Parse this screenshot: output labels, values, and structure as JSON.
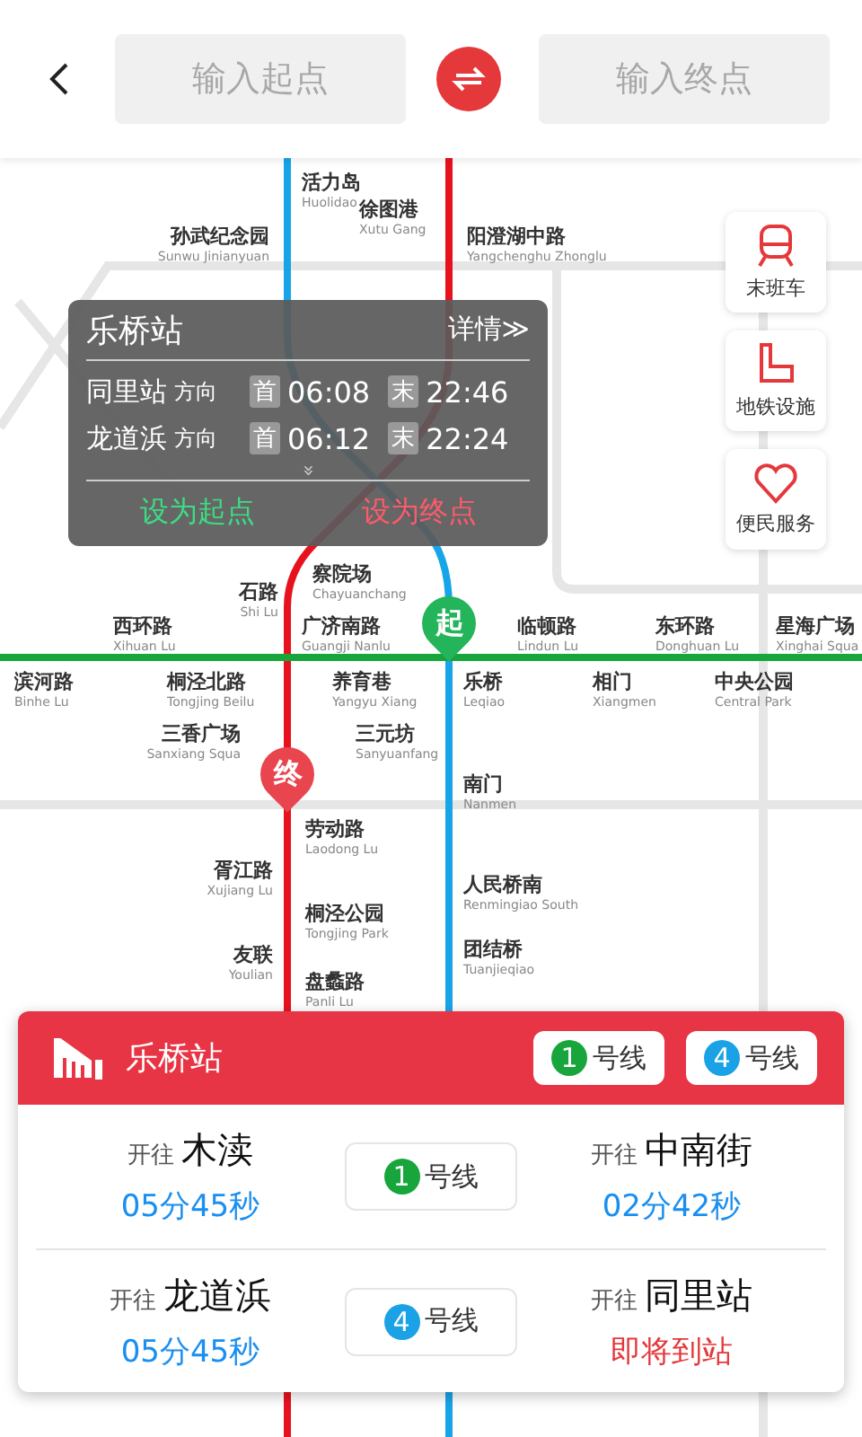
{
  "search": {
    "start_placeholder": "输入起点",
    "end_placeholder": "输入终点"
  },
  "side_buttons": [
    {
      "kind": "train",
      "label": "末班车"
    },
    {
      "kind": "facility",
      "label": "地铁设施"
    },
    {
      "kind": "service",
      "label": "便民服务"
    }
  ],
  "map": {
    "stations": [
      {
        "name": "活力岛",
        "name_en": "Huolidao"
      },
      {
        "name": "徐图港",
        "name_en": "Xutu Gang"
      },
      {
        "name": "孙武纪念园",
        "name_en": "Sunwu Jinianyuan"
      },
      {
        "name": "阳澄湖中路",
        "name_en": "Yangchenghu Zhonglu"
      },
      {
        "name": "石路",
        "name_en": "Shi Lu"
      },
      {
        "name": "察院场",
        "name_en": "Chayuanchang"
      },
      {
        "name": "西环路",
        "name_en": "Xihuan Lu"
      },
      {
        "name": "广济南路",
        "name_en": "Guangji Nanlu"
      },
      {
        "name": "临顿路",
        "name_en": "Lindun Lu"
      },
      {
        "name": "东环路",
        "name_en": "Donghuan Lu"
      },
      {
        "name": "星海广场",
        "name_en": "Xinghai Squa"
      },
      {
        "name": "滨河路",
        "name_en": "Binhe Lu"
      },
      {
        "name": "桐泾北路",
        "name_en": "Tongjing Beilu"
      },
      {
        "name": "养育巷",
        "name_en": "Yangyu Xiang"
      },
      {
        "name": "乐桥",
        "name_en": "Leqiao"
      },
      {
        "name": "相门",
        "name_en": "Xiangmen"
      },
      {
        "name": "中央公园",
        "name_en": "Central Park"
      },
      {
        "name": "三香广场",
        "name_en": "Sanxiang Squa"
      },
      {
        "name": "三元坊",
        "name_en": "Sanyuanfang"
      },
      {
        "name": "南门",
        "name_en": "Nanmen"
      },
      {
        "name": "劳动路",
        "name_en": "Laodong Lu"
      },
      {
        "name": "胥江路",
        "name_en": "Xujiang Lu"
      },
      {
        "name": "人民桥南",
        "name_en": "Renmingiao South"
      },
      {
        "name": "桐泾公园",
        "name_en": "Tongjing Park"
      },
      {
        "name": "友联",
        "name_en": "Youlian"
      },
      {
        "name": "团结桥",
        "name_en": "Tuanjieqiao"
      },
      {
        "name": "盘蠡路",
        "name_en": "Panli Lu"
      }
    ],
    "start_pin": "起",
    "end_pin": "终"
  },
  "popup": {
    "station": "乐桥站",
    "details": "详情≫",
    "directions": [
      {
        "station": "同里站",
        "suffix": "方向",
        "first_tag": "首",
        "first": "06:08",
        "last_tag": "末",
        "last": "22:46"
      },
      {
        "station": "龙道浜",
        "suffix": "方向",
        "first_tag": "首",
        "first": "06:12",
        "last_tag": "末",
        "last": "22:24"
      }
    ],
    "more": "»",
    "actions": [
      {
        "kind": "start",
        "label": "设为起点"
      },
      {
        "kind": "end",
        "label": "设为终点"
      }
    ]
  },
  "card": {
    "station": "乐桥站",
    "lines": [
      {
        "number": "1",
        "label": "号线",
        "color": "#17a53c"
      },
      {
        "number": "4",
        "label": "号线",
        "color": "#1aa1e6"
      }
    ],
    "rows": [
      {
        "line": {
          "number": "1",
          "label": "号线",
          "color": "#17a53c"
        },
        "left": {
          "prefix": "开往",
          "terminal": "木渎",
          "time": "05分45秒",
          "arriving": false
        },
        "right": {
          "prefix": "开往",
          "terminal": "中南街",
          "time": "02分42秒",
          "arriving": false
        }
      },
      {
        "line": {
          "number": "4",
          "label": "号线",
          "color": "#1aa1e6"
        },
        "left": {
          "prefix": "开往",
          "terminal": "龙道浜",
          "time": "05分45秒",
          "arriving": false
        },
        "right": {
          "prefix": "开往",
          "terminal": "同里站",
          "time": "即将到站",
          "arriving": true
        }
      }
    ]
  }
}
